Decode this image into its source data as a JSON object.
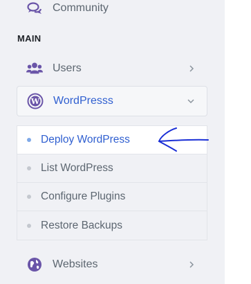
{
  "sidebar": {
    "community_label": "Community",
    "section_main": "MAIN",
    "users_label": "Users",
    "wordpress_label": "WordPresss",
    "websites_label": "Websites",
    "submenu": [
      {
        "label": "Deploy WordPress",
        "active": true
      },
      {
        "label": "List WordPress",
        "active": false
      },
      {
        "label": "Configure Plugins",
        "active": false
      },
      {
        "label": "Restore Backups",
        "active": false
      }
    ]
  },
  "icons": {
    "community": "chat-bubbles-icon",
    "users": "users-group-icon",
    "wordpress": "wordpress-logo-icon",
    "websites": "globe-icon"
  },
  "colors": {
    "sidebar_bg": "#f0f1f5",
    "accent": "#2f5fd0",
    "icon": "#6a55a8",
    "annotation": "#1a2fd6"
  }
}
